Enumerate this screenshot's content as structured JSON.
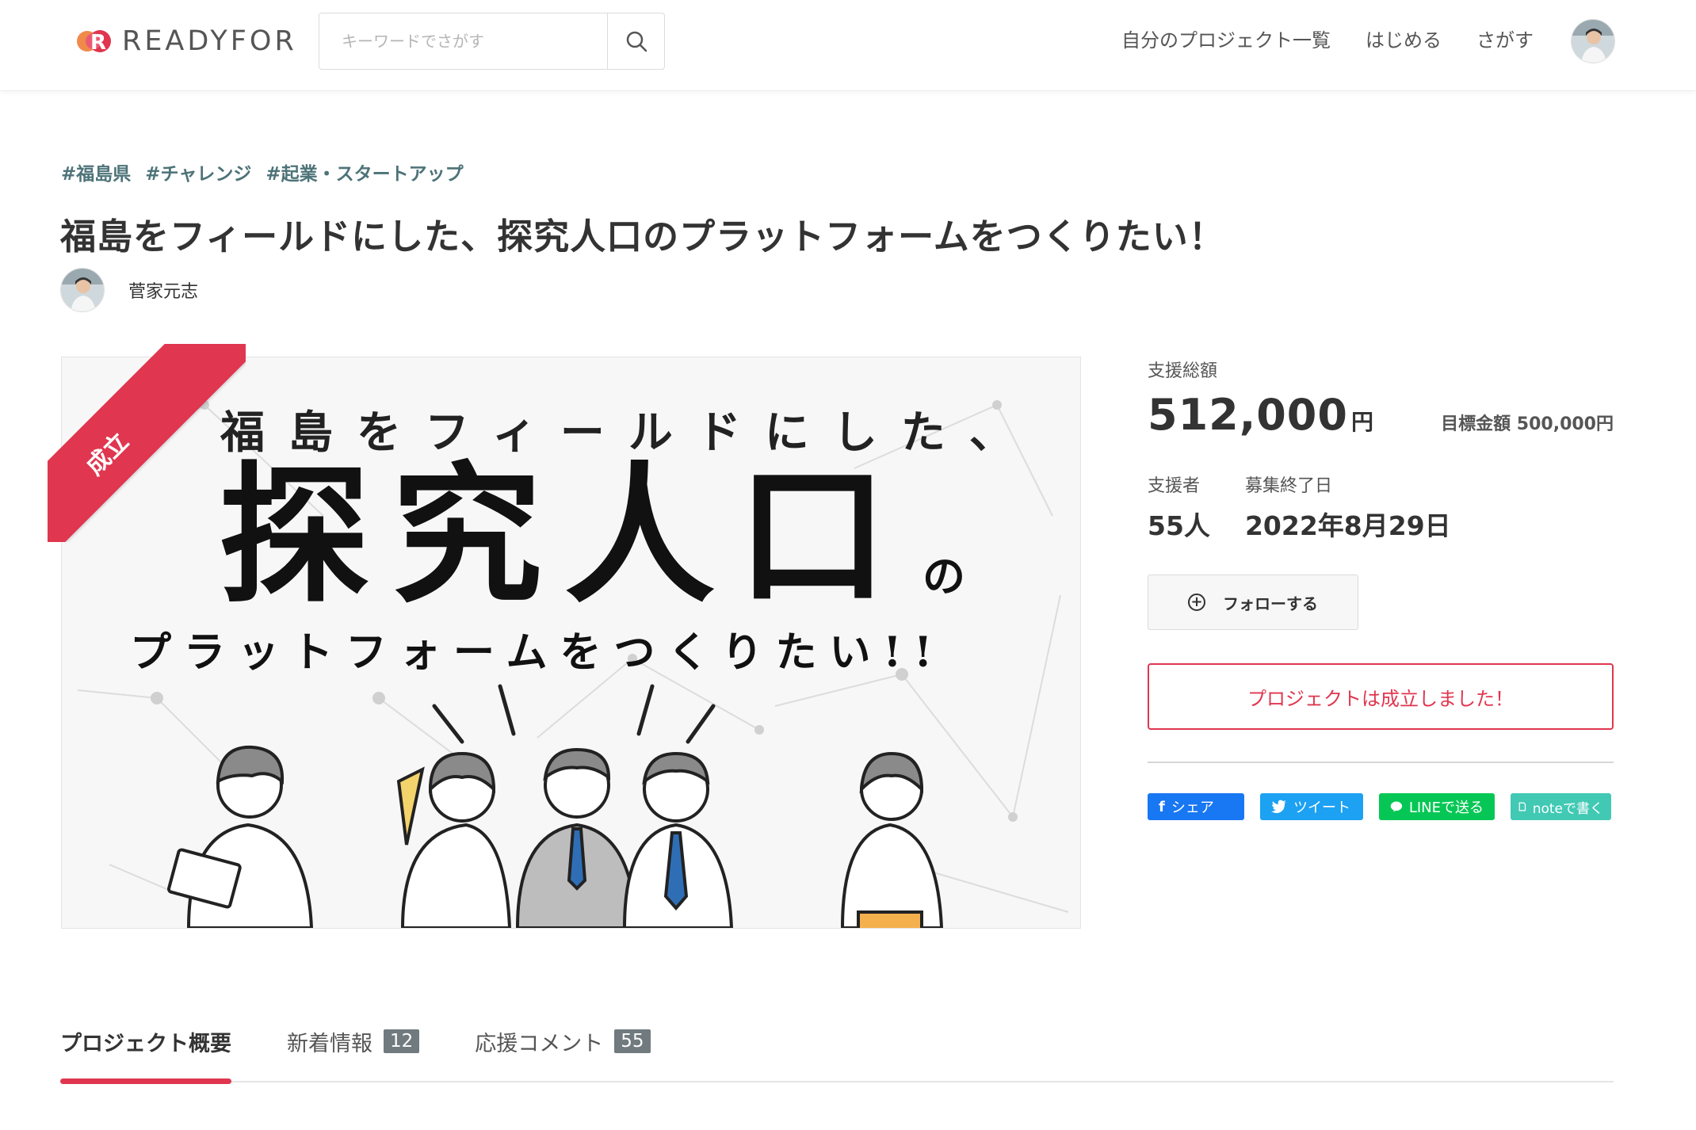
{
  "header": {
    "logo_text": "READYFOR",
    "search_placeholder": "キーワードでさがす",
    "nav": [
      "自分のプロジェクト一覧",
      "はじめる",
      "さがす"
    ]
  },
  "project": {
    "tags": [
      "#福島県",
      "#チャレンジ",
      "#起業・スタートアップ"
    ],
    "title": "福島をフィールドにした、探究人口のプラットフォームをつくりたい！",
    "owner_name": "菅家元志"
  },
  "hero": {
    "ribbon": "成立",
    "line1": "福島をフィールドにした、",
    "line2": "探究人口",
    "line2_suffix": "の",
    "line3": "プラットフォームをつくりたい!!"
  },
  "panel": {
    "total_label": "支援総額",
    "total_amount": "512,000",
    "currency": "円",
    "goal": "目標金額 500,000円",
    "supporters_label": "支援者",
    "supporters_value": "55人",
    "end_label": "募集終了日",
    "end_value": "2022年8月29日",
    "follow_label": "フォローする",
    "success_message": "プロジェクトは成立しました！",
    "share_buttons": {
      "facebook": "シェア",
      "twitter": "ツイート",
      "line": "LINEで送る",
      "note": "noteで書く"
    }
  },
  "tabs": [
    {
      "label": "プロジェクト概要",
      "count": null
    },
    {
      "label": "新着情報",
      "count": "12"
    },
    {
      "label": "応援コメント",
      "count": "55"
    }
  ],
  "colors": {
    "accent": "#e0364f",
    "tag": "#4d7378",
    "facebook": "#1877f2",
    "twitter": "#1da1f2",
    "line": "#06c755",
    "note": "#41c9b4"
  }
}
